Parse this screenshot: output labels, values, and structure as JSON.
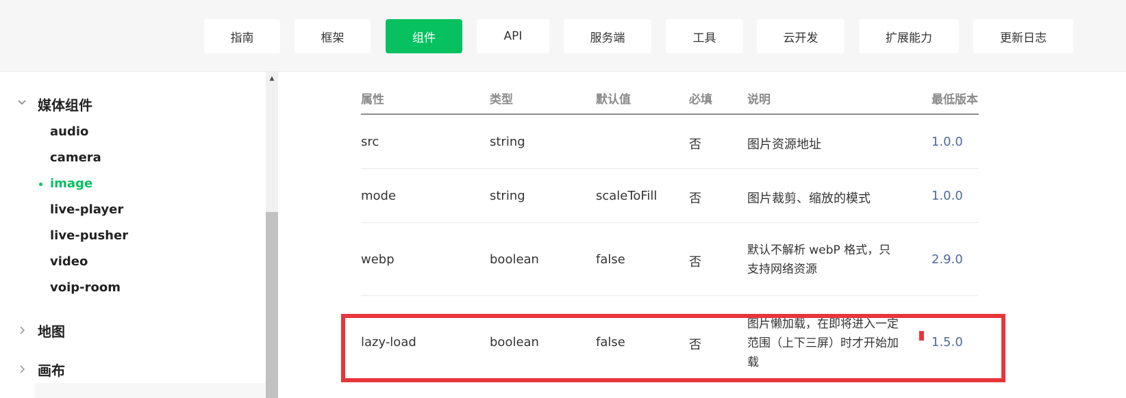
{
  "nav": {
    "items": [
      {
        "label": "指南",
        "active": false
      },
      {
        "label": "框架",
        "active": false
      },
      {
        "label": "组件",
        "active": true
      },
      {
        "label": "API",
        "active": false
      },
      {
        "label": "服务端",
        "active": false
      },
      {
        "label": "工具",
        "active": false
      },
      {
        "label": "云开发",
        "active": false
      },
      {
        "label": "扩展能力",
        "active": false
      },
      {
        "label": "更新日志",
        "active": false
      }
    ],
    "active_color": "#07c160"
  },
  "sidebar": {
    "groups": [
      {
        "label": "媒体组件",
        "expanded": true,
        "icon": "chevron-down-icon",
        "items": [
          "audio",
          "camera",
          "image",
          "live-player",
          "live-pusher",
          "video",
          "voip-room"
        ],
        "active_item": "image"
      },
      {
        "label": "地图",
        "expanded": false,
        "icon": "chevron-right-icon"
      },
      {
        "label": "画布",
        "expanded": false,
        "icon": "chevron-right-icon"
      }
    ]
  },
  "table": {
    "headers": [
      "属性",
      "类型",
      "默认值",
      "必填",
      "说明",
      "最低版本"
    ],
    "rows": [
      {
        "attr": "src",
        "type": "string",
        "default": "",
        "required": "否",
        "desc": "图片资源地址",
        "version": "1.0.0"
      },
      {
        "attr": "mode",
        "type": "string",
        "default": "scaleToFill",
        "required": "否",
        "desc": "图片裁剪、缩放的模式",
        "version": "1.0.0"
      },
      {
        "attr": "webp",
        "type": "boolean",
        "default": "false",
        "required": "否",
        "desc": "默认不解析 webP 格式，只支持网络资源",
        "version": "2.9.0"
      },
      {
        "attr": "lazy-load",
        "type": "boolean",
        "default": "false",
        "required": "否",
        "desc": "图片懒加载，在即将进入一定范围（上下三屏）时才开始加载",
        "version": "1.5.0",
        "highlighted": true
      }
    ],
    "version_color": "#4e6a9c",
    "highlight_color": "#e8353a"
  }
}
